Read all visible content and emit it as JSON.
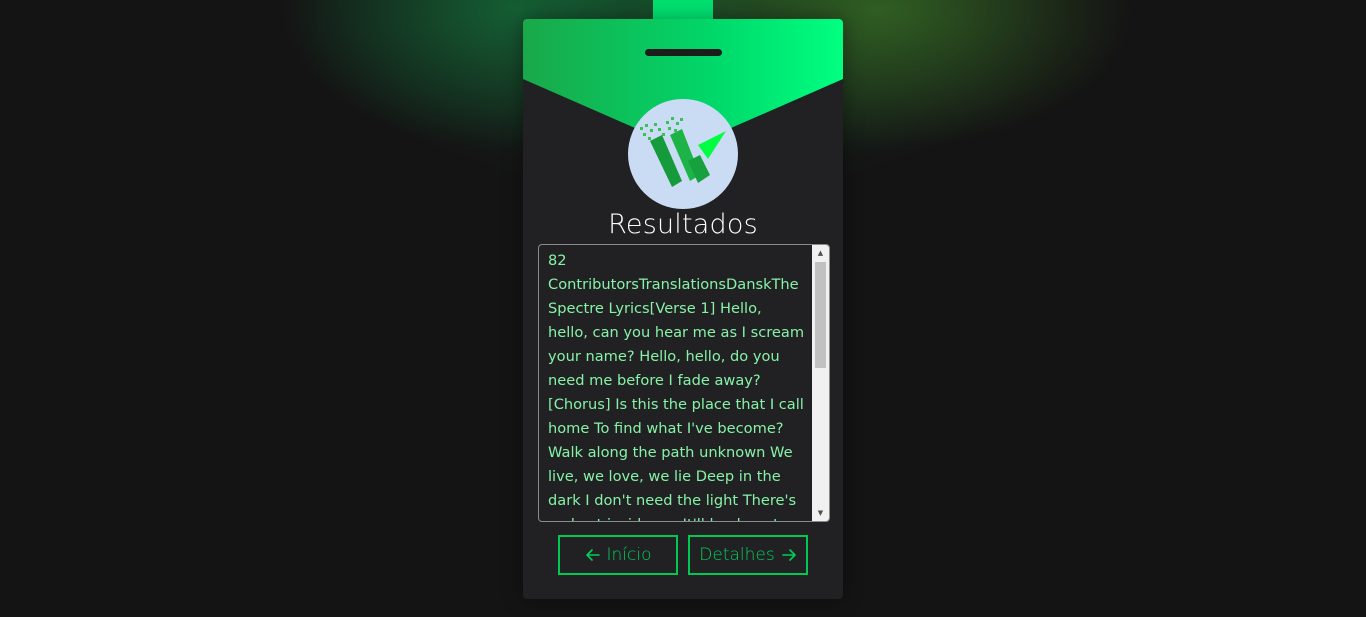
{
  "colors": {
    "background": "#141414",
    "card": "#212124",
    "accent": "#00e070",
    "text_green": "#86f2a6",
    "button_green": "#00c853"
  },
  "header": {
    "logo_icon": "w-logo-icon"
  },
  "main": {
    "title": "Resultados",
    "results_text": "82 ContributorsTranslationsDanskThe Spectre Lyrics[Verse 1] Hello, hello, can you hear me as I scream your name? Hello, hello, do you need me before I fade away? [Chorus] Is this the place that I call home To find what I've become? Walk along the path unknown We live, we love, we lie Deep in the dark I don't need the light There's a ghost inside me It'll lead me to the other side We"
  },
  "buttons": {
    "back_label": "Início",
    "back_icon": "arrow-left-icon",
    "next_label": "Detalhes",
    "next_icon": "arrow-right-icon"
  },
  "scrollbar": {
    "up_icon": "scroll-up-arrow-icon",
    "down_icon": "scroll-down-arrow-icon"
  }
}
